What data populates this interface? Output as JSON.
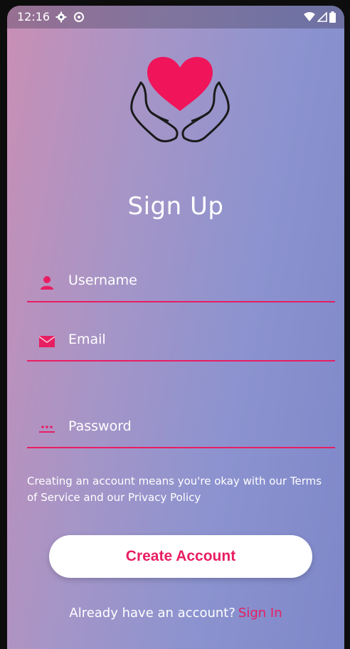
{
  "status_bar": {
    "time": "12:16",
    "icons": [
      "gear-icon",
      "sync-icon",
      "wifi-icon",
      "signal-icon",
      "battery-icon"
    ]
  },
  "logo": {
    "icon": "heart-in-hands-icon",
    "heart_color": "#f0145a"
  },
  "title": "Sign Up",
  "form": {
    "username": {
      "label": "Username",
      "icon": "person-icon",
      "value": ""
    },
    "email": {
      "label": "Email",
      "icon": "mail-icon",
      "value": ""
    },
    "password": {
      "label": "Password",
      "icon": "password-icon",
      "value": ""
    }
  },
  "terms_text": "Creating an account means you're okay with our Terms of Service and our Privacy Policy",
  "create_account_label": "Create Account",
  "signin_prompt": "Already have an account?",
  "signin_link": "Sign In",
  "colors": {
    "accent": "#e81e63",
    "text": "#ffffff",
    "gradient_start": "#c98fb5",
    "gradient_end": "#7e87c9"
  }
}
